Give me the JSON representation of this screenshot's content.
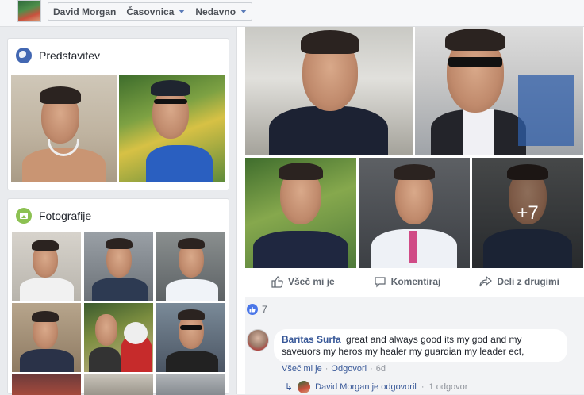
{
  "header": {
    "crumbs": [
      {
        "label": "David Morgan",
        "has_caret": false
      },
      {
        "label": "Časovnica",
        "has_caret": true
      },
      {
        "label": "Nedavno",
        "has_caret": true
      }
    ]
  },
  "intro": {
    "title": "Predstavitev"
  },
  "photos": {
    "title": "Fotografije"
  },
  "post": {
    "more_count": "+7",
    "actions": {
      "like": "Všeč mi je",
      "comment": "Komentiraj",
      "share": "Deli z drugimi"
    },
    "likes_count": "7",
    "comment": {
      "author": "Baritas Surfa",
      "text": "great and always good its my god and my saveuors my heros my healer my guardian my leader ect,",
      "like_label": "Všeč mi je",
      "reply_label": "Odgovori",
      "time": "6d"
    },
    "reply": {
      "text": "David Morgan je odgovoril",
      "count": "1 odgovor"
    }
  },
  "colors": {
    "link": "#385898",
    "accent": "#4267b2",
    "background": "#e9ebee"
  }
}
